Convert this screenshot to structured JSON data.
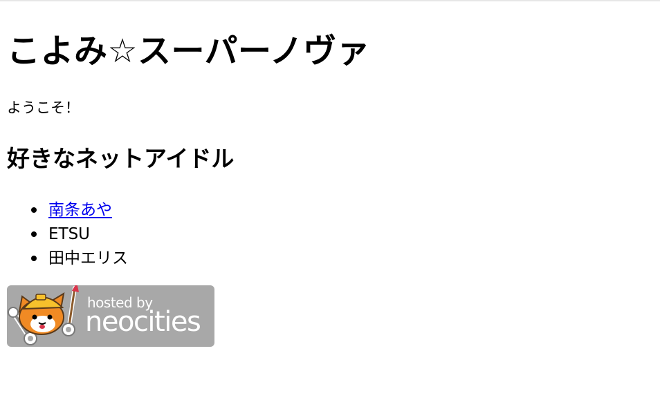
{
  "page": {
    "title": "こよみ☆スーパーノヴァ",
    "welcome": "ようこそ！",
    "section_heading": "好きなネットアイドル"
  },
  "idols": [
    {
      "name": "南条あや",
      "link": true
    },
    {
      "name": "ETSU",
      "link": false
    },
    {
      "name": "田中エリス",
      "link": false
    }
  ],
  "badge": {
    "hosted_by": "hosted by",
    "brand": "neocities",
    "icons": [
      "cat-mascot-icon",
      "wrench-icon",
      "paintbrush-icon"
    ]
  },
  "colors": {
    "link": "#0000ee",
    "badge_background": "#a8a8a8",
    "cat_orange": "#f08a24",
    "helmet_yellow": "#f7c12c"
  }
}
